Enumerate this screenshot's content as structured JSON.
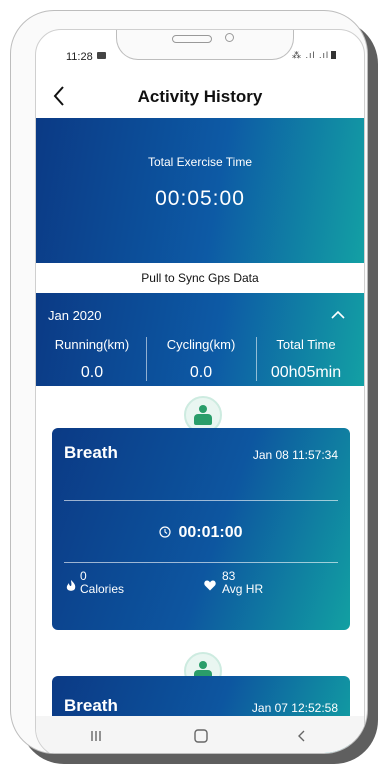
{
  "status_bar": {
    "time": "11:28",
    "icons": "⁂ .ıl .ıl"
  },
  "header": {
    "title": "Activity History",
    "back_icon": "chevron-left-icon"
  },
  "summary": {
    "label": "Total Exercise Time",
    "value": "00:05:00"
  },
  "sync_hint": "Pull to Sync Gps Data",
  "month": {
    "label": "Jan 2020",
    "stats": [
      {
        "label": "Running(km)",
        "value": "0.0"
      },
      {
        "label": "Cycling(km)",
        "value": "0.0"
      },
      {
        "label": "Total Time",
        "value": "00h05min"
      }
    ]
  },
  "activities": [
    {
      "name": "Breath",
      "date": "Jan 08  11:57:34",
      "duration": "00:01:00",
      "calories_value": "0",
      "calories_label": "Calories",
      "hr_value": "83",
      "hr_label": "Avg HR"
    },
    {
      "name": "Breath",
      "date": "Jan 07  12:52:58"
    }
  ],
  "colors": {
    "gradient_start": "#0b3a85",
    "gradient_end": "#13a0a4",
    "icon_green": "#2a9d6a"
  },
  "nav": {
    "recents_icon": "recent-apps-icon",
    "home_icon": "home-icon",
    "back_icon": "back-icon"
  }
}
